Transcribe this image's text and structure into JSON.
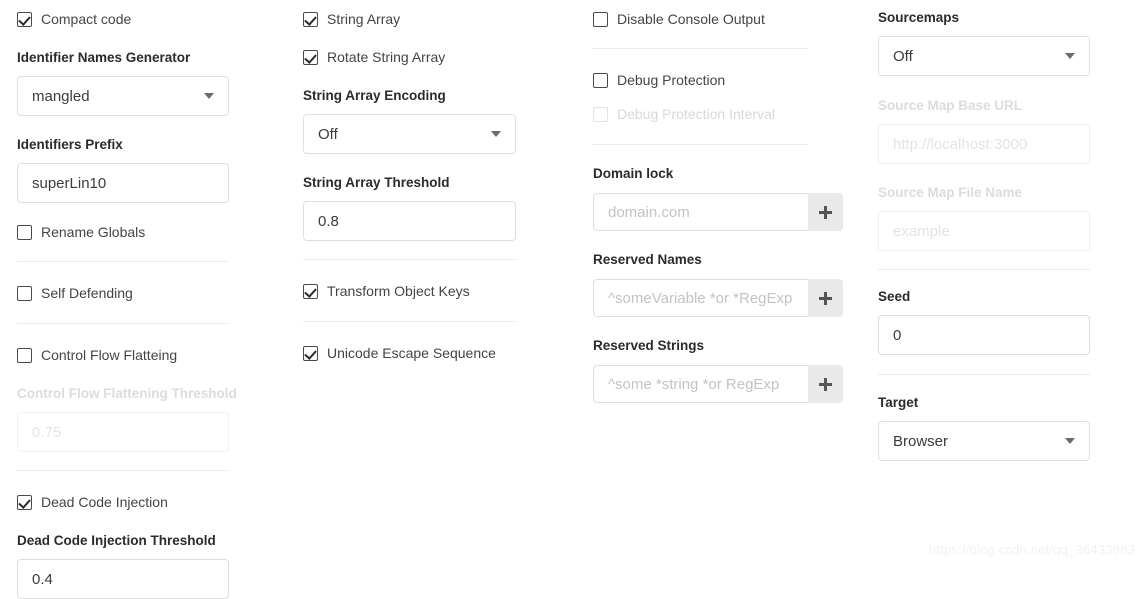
{
  "columns": {
    "col1": {
      "compact_code": {
        "label": "Compact code",
        "checked": true
      },
      "identifier_names_generator": {
        "label": "Identifier Names Generator",
        "value": "mangled"
      },
      "identifiers_prefix": {
        "label": "Identifiers Prefix",
        "value": "superLin10"
      },
      "rename_globals": {
        "label": "Rename Globals",
        "checked": false
      },
      "self_defending": {
        "label": "Self Defending",
        "checked": false
      },
      "control_flow_flattening": {
        "label": "Control Flow Flatteing",
        "checked": false
      },
      "control_flow_flattening_threshold": {
        "label": "Control Flow Flattening Threshold",
        "value": "0.75",
        "disabled": true
      },
      "dead_code_injection": {
        "label": "Dead Code Injection",
        "checked": true
      },
      "dead_code_injection_threshold": {
        "label": "Dead Code Injection Threshold",
        "value": "0.4"
      }
    },
    "col2": {
      "string_array": {
        "label": "String Array",
        "checked": true
      },
      "rotate_string_array": {
        "label": "Rotate String Array",
        "checked": true
      },
      "string_array_encoding": {
        "label": "String Array Encoding",
        "value": "Off"
      },
      "string_array_threshold": {
        "label": "String Array Threshold",
        "value": "0.8"
      },
      "transform_object_keys": {
        "label": "Transform Object Keys",
        "checked": true
      },
      "unicode_escape_sequence": {
        "label": "Unicode Escape Sequence",
        "checked": true
      }
    },
    "col3": {
      "disable_console_output": {
        "label": "Disable Console Output",
        "checked": false
      },
      "debug_protection": {
        "label": "Debug Protection",
        "checked": false
      },
      "debug_protection_interval": {
        "label": "Debug Protection Interval",
        "checked": false,
        "disabled": true
      },
      "domain_lock": {
        "label": "Domain lock",
        "placeholder": "domain.com",
        "value": "",
        "add_button": "+"
      },
      "reserved_names": {
        "label": "Reserved Names",
        "placeholder": "^someVariable *or *RegExp",
        "value": "",
        "add_button": "+"
      },
      "reserved_strings": {
        "label": "Reserved Strings",
        "placeholder": "^some *string *or RegExp",
        "value": "",
        "add_button": "+"
      }
    },
    "col4": {
      "sourcemaps": {
        "label": "Sourcemaps",
        "value": "Off"
      },
      "source_map_base_url": {
        "label": "Source Map Base URL",
        "placeholder": "http://localhost:3000",
        "value": "",
        "disabled": true
      },
      "source_map_file_name": {
        "label": "Source Map File Name",
        "placeholder": "example",
        "value": "",
        "disabled": true
      },
      "seed": {
        "label": "Seed",
        "value": "0"
      },
      "target": {
        "label": "Target",
        "value": "Browser"
      }
    }
  },
  "watermark": {
    "text": "https://blog.csdn.net/qq_36433883"
  },
  "icons": {
    "caret": "chevron-down-icon",
    "plus": "plus-icon",
    "check": "check-icon"
  }
}
